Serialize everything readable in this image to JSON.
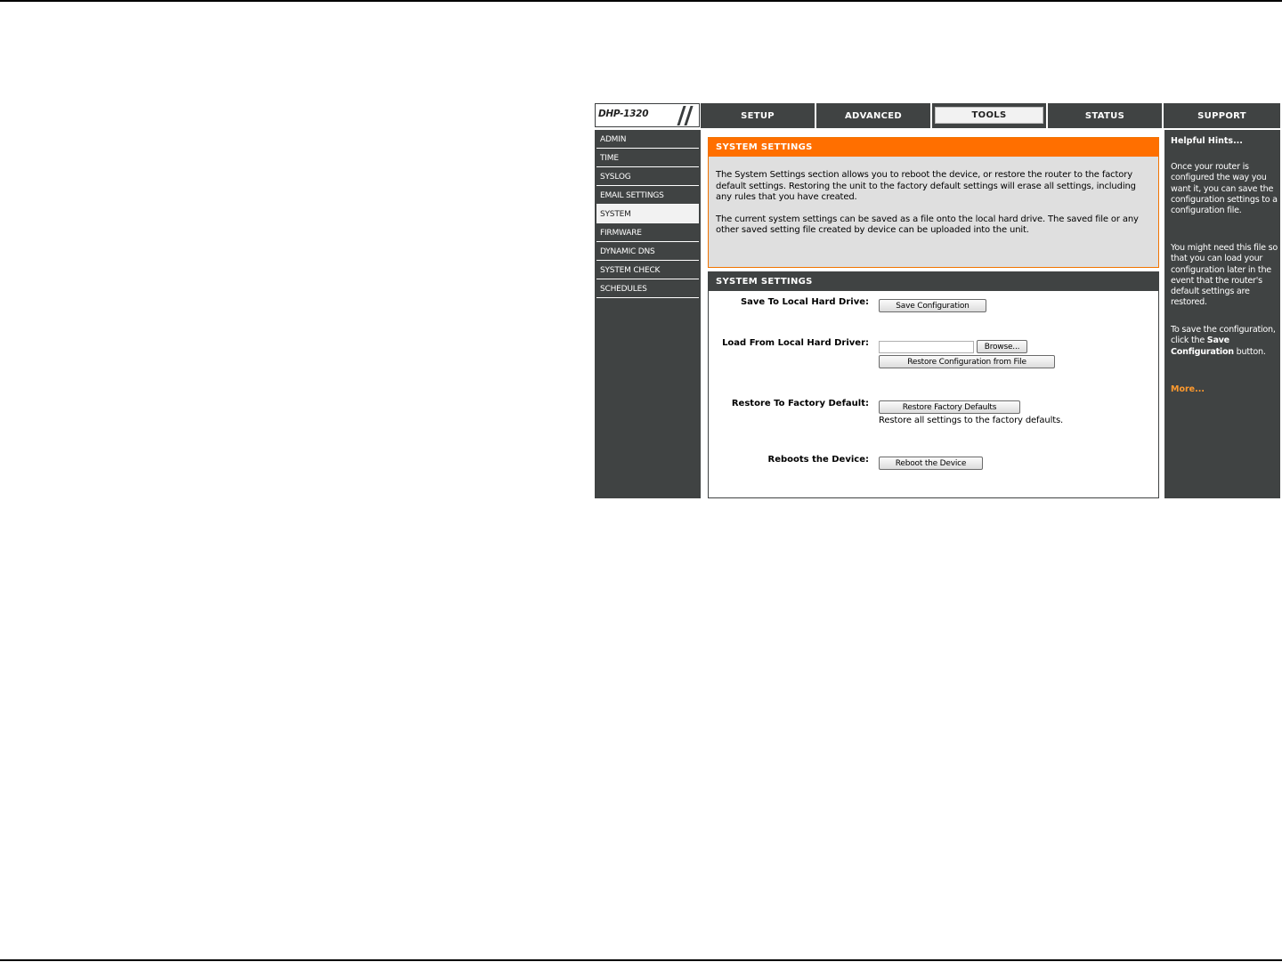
{
  "logo": {
    "model": "DHP-1320"
  },
  "tabs": [
    {
      "id": "setup",
      "label": "SETUP"
    },
    {
      "id": "advanced",
      "label": "ADVANCED"
    },
    {
      "id": "tools",
      "label": "TOOLS",
      "active": true
    },
    {
      "id": "status",
      "label": "STATUS"
    },
    {
      "id": "support",
      "label": "SUPPORT"
    }
  ],
  "sidebar": {
    "items": [
      {
        "label": "ADMIN"
      },
      {
        "label": "TIME"
      },
      {
        "label": "SYSLOG"
      },
      {
        "label": "EMAIL SETTINGS"
      },
      {
        "label": "SYSTEM",
        "active": true
      },
      {
        "label": "FIRMWARE"
      },
      {
        "label": "DYNAMIC DNS"
      },
      {
        "label": "SYSTEM CHECK"
      },
      {
        "label": "SCHEDULES"
      }
    ]
  },
  "intro": {
    "title": "SYSTEM SETTINGS",
    "paragraph1": "The System Settings section allows you to reboot the device, or restore the router to the factory default settings. Restoring the unit to the factory default settings will erase all settings, including any rules that you have created.",
    "paragraph2": "The current system settings can be saved as a file onto the local hard drive. The saved file or any other saved setting file created by device can be uploaded into the unit."
  },
  "settings": {
    "title": "SYSTEM SETTINGS",
    "save_label": "Save To Local Hard Drive:",
    "save_button": "Save Configuration",
    "load_label": "Load From Local Hard Driver:",
    "file_value": "",
    "browse_button": "Browse...",
    "restore_file_button": "Restore Configuration from File",
    "factory_label": "Restore To Factory Default:",
    "factory_button": "Restore Factory Defaults",
    "factory_note": "Restore all settings to the factory defaults.",
    "reboot_label": "Reboots the Device:",
    "reboot_button": "Reboot the Device"
  },
  "hints": {
    "title": "Helpful Hints...",
    "p1": "Once your router is configured the way you want it, you can save the configuration settings to a configuration file.",
    "p2": "You might need this file so that you can load your configuration later in the event that the router's default settings are restored.",
    "p3_before": "To save the configuration, click the ",
    "p3_bold": "Save Configuration",
    "p3_after": " button.",
    "more": "More..."
  },
  "colors": {
    "dark": "#404343",
    "orange": "#ff6f00",
    "hint_link": "#ff9a2e",
    "panel_gray": "#dfdfdf"
  }
}
